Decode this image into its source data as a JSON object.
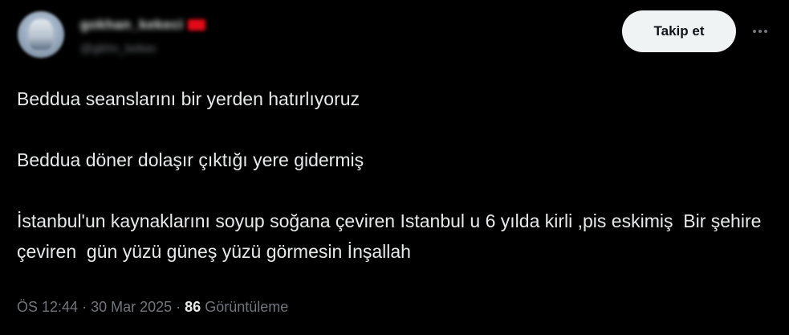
{
  "author": {
    "display_name": "gokhan_kekeci",
    "handle": "@gkhn_kekec",
    "flag_icon": "turkey-flag-icon",
    "avatar_icon": "profile-avatar"
  },
  "actions": {
    "follow_label": "Takip et",
    "more_icon": "more-options-icon"
  },
  "tweet": {
    "paragraphs": [
      "Beddua seanslarını bir yerden hatırlıyoruz",
      "Beddua döner dolaşır çıktığı yere gidermiş",
      "İstanbul'un kaynaklarını soyup soğana çeviren Istanbul u 6 yılda kirli ,pis eskimiş  Bir şehire çeviren  gün yüzü güneş yüzü görmesin İnşallah"
    ]
  },
  "meta": {
    "time": "ÖS 12:44",
    "separator": " · ",
    "date": "30 Mar 2025",
    "views_count": "86",
    "views_label": "Görüntüleme"
  },
  "colors": {
    "background": "#000000",
    "text": "#e7e9ea",
    "secondary": "#71767b",
    "button_bg": "#eff3f4",
    "button_text": "#0f1419"
  }
}
